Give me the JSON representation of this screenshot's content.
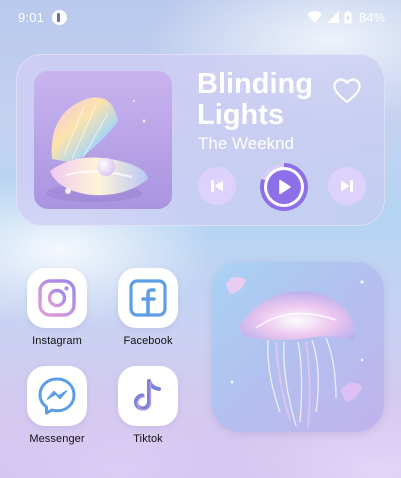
{
  "status_bar": {
    "time": "9:01",
    "battery": "84%",
    "icons": [
      "notification-app-icon",
      "wifi-icon",
      "signal-icon",
      "battery-icon"
    ]
  },
  "music_widget": {
    "title": "Blinding Lights",
    "artist": "The Weeknd",
    "album_art": "pearl-shell-artwork",
    "controls": [
      "previous-icon",
      "play-icon",
      "next-icon",
      "heart-icon"
    ],
    "progress": 0.8,
    "colors": {
      "accent": "#8c6fe9",
      "button_bg": "#ded2fc"
    }
  },
  "apps": [
    {
      "label": "Instagram",
      "icon": "instagram-icon"
    },
    {
      "label": "Facebook",
      "icon": "facebook-icon"
    },
    {
      "label": "Messenger",
      "icon": "messenger-icon"
    },
    {
      "label": "Tiktok",
      "icon": "tiktok-icon"
    }
  ],
  "photo_widget": {
    "image": "jellyfish-artwork"
  }
}
